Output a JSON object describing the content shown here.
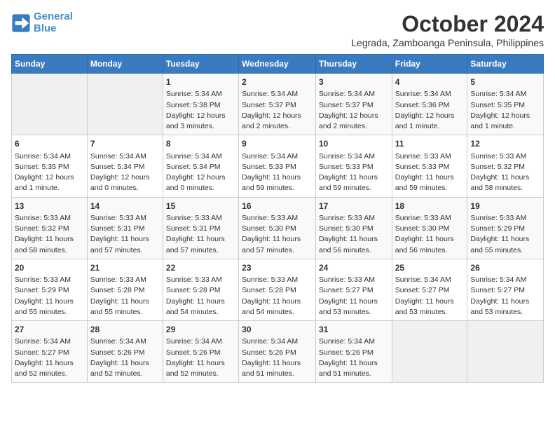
{
  "header": {
    "logo_line1": "General",
    "logo_line2": "Blue",
    "month": "October 2024",
    "location": "Legrada, Zamboanga Peninsula, Philippines"
  },
  "days_of_week": [
    "Sunday",
    "Monday",
    "Tuesday",
    "Wednesday",
    "Thursday",
    "Friday",
    "Saturday"
  ],
  "weeks": [
    [
      {
        "day": "",
        "sunrise": "",
        "sunset": "",
        "daylight": "",
        "empty": true
      },
      {
        "day": "",
        "sunrise": "",
        "sunset": "",
        "daylight": "",
        "empty": true
      },
      {
        "day": "1",
        "sunrise": "Sunrise: 5:34 AM",
        "sunset": "Sunset: 5:38 PM",
        "daylight": "Daylight: 12 hours and 3 minutes."
      },
      {
        "day": "2",
        "sunrise": "Sunrise: 5:34 AM",
        "sunset": "Sunset: 5:37 PM",
        "daylight": "Daylight: 12 hours and 2 minutes."
      },
      {
        "day": "3",
        "sunrise": "Sunrise: 5:34 AM",
        "sunset": "Sunset: 5:37 PM",
        "daylight": "Daylight: 12 hours and 2 minutes."
      },
      {
        "day": "4",
        "sunrise": "Sunrise: 5:34 AM",
        "sunset": "Sunset: 5:36 PM",
        "daylight": "Daylight: 12 hours and 1 minute."
      },
      {
        "day": "5",
        "sunrise": "Sunrise: 5:34 AM",
        "sunset": "Sunset: 5:35 PM",
        "daylight": "Daylight: 12 hours and 1 minute."
      }
    ],
    [
      {
        "day": "6",
        "sunrise": "Sunrise: 5:34 AM",
        "sunset": "Sunset: 5:35 PM",
        "daylight": "Daylight: 12 hours and 1 minute."
      },
      {
        "day": "7",
        "sunrise": "Sunrise: 5:34 AM",
        "sunset": "Sunset: 5:34 PM",
        "daylight": "Daylight: 12 hours and 0 minutes."
      },
      {
        "day": "8",
        "sunrise": "Sunrise: 5:34 AM",
        "sunset": "Sunset: 5:34 PM",
        "daylight": "Daylight: 12 hours and 0 minutes."
      },
      {
        "day": "9",
        "sunrise": "Sunrise: 5:34 AM",
        "sunset": "Sunset: 5:33 PM",
        "daylight": "Daylight: 11 hours and 59 minutes."
      },
      {
        "day": "10",
        "sunrise": "Sunrise: 5:34 AM",
        "sunset": "Sunset: 5:33 PM",
        "daylight": "Daylight: 11 hours and 59 minutes."
      },
      {
        "day": "11",
        "sunrise": "Sunrise: 5:33 AM",
        "sunset": "Sunset: 5:33 PM",
        "daylight": "Daylight: 11 hours and 59 minutes."
      },
      {
        "day": "12",
        "sunrise": "Sunrise: 5:33 AM",
        "sunset": "Sunset: 5:32 PM",
        "daylight": "Daylight: 11 hours and 58 minutes."
      }
    ],
    [
      {
        "day": "13",
        "sunrise": "Sunrise: 5:33 AM",
        "sunset": "Sunset: 5:32 PM",
        "daylight": "Daylight: 11 hours and 58 minutes."
      },
      {
        "day": "14",
        "sunrise": "Sunrise: 5:33 AM",
        "sunset": "Sunset: 5:31 PM",
        "daylight": "Daylight: 11 hours and 57 minutes."
      },
      {
        "day": "15",
        "sunrise": "Sunrise: 5:33 AM",
        "sunset": "Sunset: 5:31 PM",
        "daylight": "Daylight: 11 hours and 57 minutes."
      },
      {
        "day": "16",
        "sunrise": "Sunrise: 5:33 AM",
        "sunset": "Sunset: 5:30 PM",
        "daylight": "Daylight: 11 hours and 57 minutes."
      },
      {
        "day": "17",
        "sunrise": "Sunrise: 5:33 AM",
        "sunset": "Sunset: 5:30 PM",
        "daylight": "Daylight: 11 hours and 56 minutes."
      },
      {
        "day": "18",
        "sunrise": "Sunrise: 5:33 AM",
        "sunset": "Sunset: 5:30 PM",
        "daylight": "Daylight: 11 hours and 56 minutes."
      },
      {
        "day": "19",
        "sunrise": "Sunrise: 5:33 AM",
        "sunset": "Sunset: 5:29 PM",
        "daylight": "Daylight: 11 hours and 55 minutes."
      }
    ],
    [
      {
        "day": "20",
        "sunrise": "Sunrise: 5:33 AM",
        "sunset": "Sunset: 5:29 PM",
        "daylight": "Daylight: 11 hours and 55 minutes."
      },
      {
        "day": "21",
        "sunrise": "Sunrise: 5:33 AM",
        "sunset": "Sunset: 5:28 PM",
        "daylight": "Daylight: 11 hours and 55 minutes."
      },
      {
        "day": "22",
        "sunrise": "Sunrise: 5:33 AM",
        "sunset": "Sunset: 5:28 PM",
        "daylight": "Daylight: 11 hours and 54 minutes."
      },
      {
        "day": "23",
        "sunrise": "Sunrise: 5:33 AM",
        "sunset": "Sunset: 5:28 PM",
        "daylight": "Daylight: 11 hours and 54 minutes."
      },
      {
        "day": "24",
        "sunrise": "Sunrise: 5:33 AM",
        "sunset": "Sunset: 5:27 PM",
        "daylight": "Daylight: 11 hours and 53 minutes."
      },
      {
        "day": "25",
        "sunrise": "Sunrise: 5:34 AM",
        "sunset": "Sunset: 5:27 PM",
        "daylight": "Daylight: 11 hours and 53 minutes."
      },
      {
        "day": "26",
        "sunrise": "Sunrise: 5:34 AM",
        "sunset": "Sunset: 5:27 PM",
        "daylight": "Daylight: 11 hours and 53 minutes."
      }
    ],
    [
      {
        "day": "27",
        "sunrise": "Sunrise: 5:34 AM",
        "sunset": "Sunset: 5:27 PM",
        "daylight": "Daylight: 11 hours and 52 minutes."
      },
      {
        "day": "28",
        "sunrise": "Sunrise: 5:34 AM",
        "sunset": "Sunset: 5:26 PM",
        "daylight": "Daylight: 11 hours and 52 minutes."
      },
      {
        "day": "29",
        "sunrise": "Sunrise: 5:34 AM",
        "sunset": "Sunset: 5:26 PM",
        "daylight": "Daylight: 11 hours and 52 minutes."
      },
      {
        "day": "30",
        "sunrise": "Sunrise: 5:34 AM",
        "sunset": "Sunset: 5:26 PM",
        "daylight": "Daylight: 11 hours and 51 minutes."
      },
      {
        "day": "31",
        "sunrise": "Sunrise: 5:34 AM",
        "sunset": "Sunset: 5:26 PM",
        "daylight": "Daylight: 11 hours and 51 minutes."
      },
      {
        "day": "",
        "sunrise": "",
        "sunset": "",
        "daylight": "",
        "empty": true
      },
      {
        "day": "",
        "sunrise": "",
        "sunset": "",
        "daylight": "",
        "empty": true
      }
    ]
  ]
}
